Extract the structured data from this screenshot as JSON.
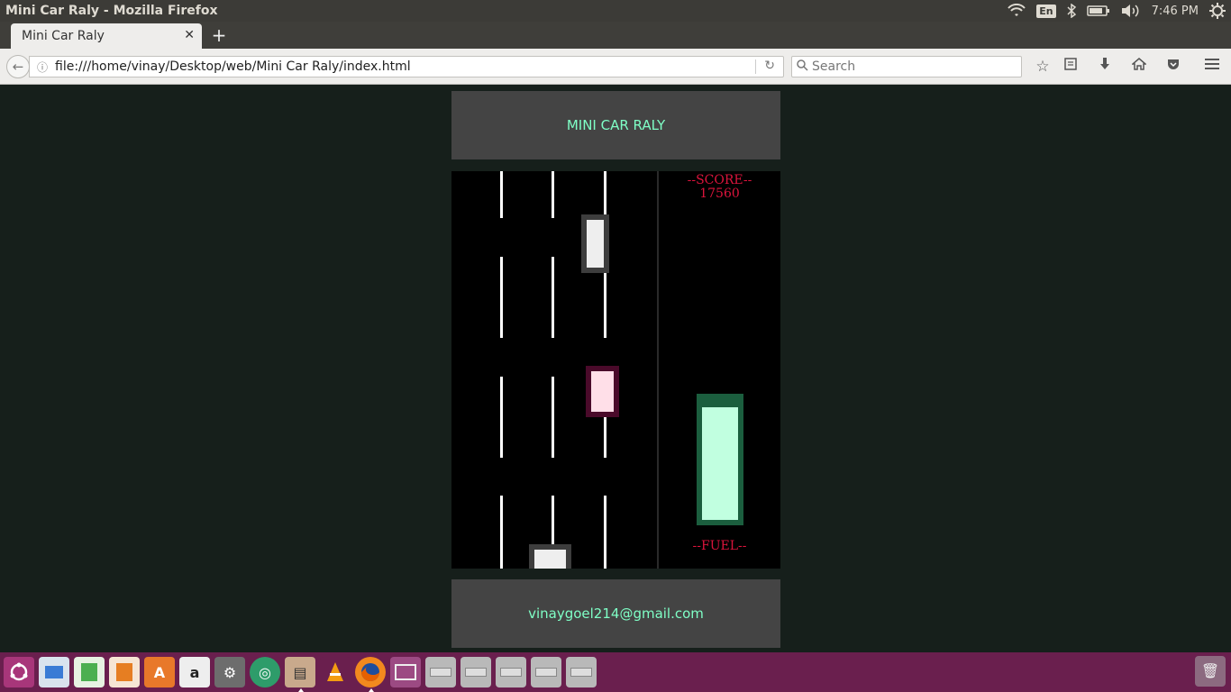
{
  "os": {
    "window_title": "Mini Car Raly - Mozilla Firefox",
    "keyboard_layout": "En",
    "clock": "7:46 PM",
    "tray_icons": [
      "wifi-icon",
      "keyboard-layout-icon",
      "bluetooth-icon",
      "battery-icon",
      "volume-icon",
      "power-settings-icon"
    ]
  },
  "browser": {
    "tab_title": "Mini Car Raly",
    "url": "file:///home/vinay/Desktop/web/Mini Car Raly/index.html",
    "search_placeholder": "Search",
    "toolbar_icons": [
      "bookmark-star-icon",
      "reading-list-icon",
      "download-icon",
      "home-icon",
      "pocket-icon",
      "menu-icon"
    ]
  },
  "page": {
    "header_title": "MINI CAR RALY",
    "score_label": "--SCORE--",
    "score_value": "17560",
    "fuel_label": "--FUEL--",
    "fuel_level": 0.93,
    "footer_email": "vinaygoel214@gmail.com",
    "colors": {
      "page_bg": "#161f1b",
      "panel_bg": "#444444",
      "accent_text": "#7fffc6",
      "score_text": "#dc143c",
      "fuel_border": "#1b5e3e",
      "fuel_fill": "#c1ffe0",
      "player_car": "#eeeeee",
      "enemy_car_gray": "#eeeeee",
      "enemy_car_pink": "#ffdfe8",
      "enemy_car_pink_border": "#4a0a2a"
    }
  },
  "launcher": {
    "icons": [
      "ubuntu-dash-icon",
      "image-viewer-icon",
      "spreadsheet-icon",
      "presentation-icon",
      "software-center-icon",
      "amazon-icon",
      "system-settings-icon",
      "network-icon",
      "file-archive-icon",
      "vlc-icon",
      "firefox-icon",
      "terminal-window-icon",
      "drive-icon",
      "drive-icon",
      "drive-icon",
      "drive-icon",
      "drive-icon"
    ],
    "trash_icon": "trash-icon"
  }
}
